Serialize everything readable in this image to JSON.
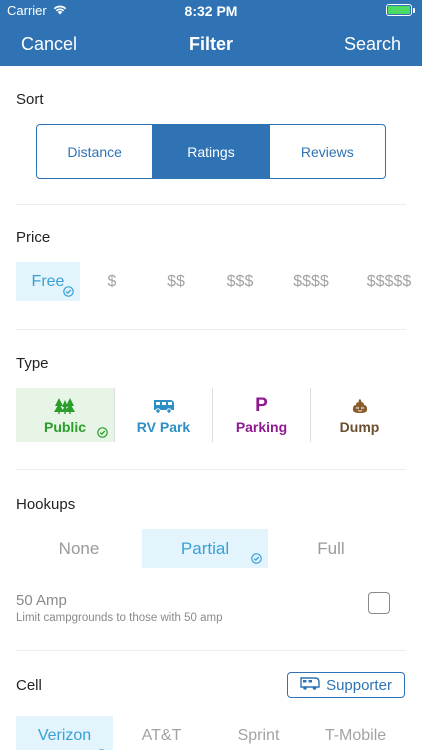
{
  "status_bar": {
    "carrier": "Carrier",
    "time": "8:32 PM"
  },
  "nav": {
    "cancel": "Cancel",
    "title": "Filter",
    "search": "Search"
  },
  "sort": {
    "title": "Sort",
    "options": [
      "Distance",
      "Ratings",
      "Reviews"
    ],
    "selected": "Ratings"
  },
  "price": {
    "title": "Price",
    "options": [
      "Free",
      "$",
      "$$",
      "$$$",
      "$$$$",
      "$$$$$"
    ],
    "selected": "Free"
  },
  "type": {
    "title": "Type",
    "options": [
      {
        "label": "Public",
        "icon": "trees-icon",
        "color": "#2a9d2a"
      },
      {
        "label": "RV Park",
        "icon": "rv-icon",
        "color": "#2e8fc4"
      },
      {
        "label": "Parking",
        "icon": "parking-icon",
        "glyph": "P",
        "color": "#8f1a8f"
      },
      {
        "label": "Dump",
        "icon": "dump-icon",
        "color": "#6b4f2e"
      }
    ],
    "selected": "Public"
  },
  "hookups": {
    "title": "Hookups",
    "options": [
      "None",
      "Partial",
      "Full"
    ],
    "selected": "Partial",
    "amp_label": "50 Amp",
    "amp_description": "Limit campgrounds to those with 50 amp",
    "amp_checked": false
  },
  "cell": {
    "title": "Cell",
    "supporter_label": "Supporter",
    "options": [
      "Verizon",
      "AT&T",
      "Sprint",
      "T-Mobile"
    ],
    "selected": "Verizon"
  },
  "colors": {
    "brand": "#2f73b5",
    "selected_blue": "#39a0d6",
    "selected_green": "#2a9d2a"
  }
}
